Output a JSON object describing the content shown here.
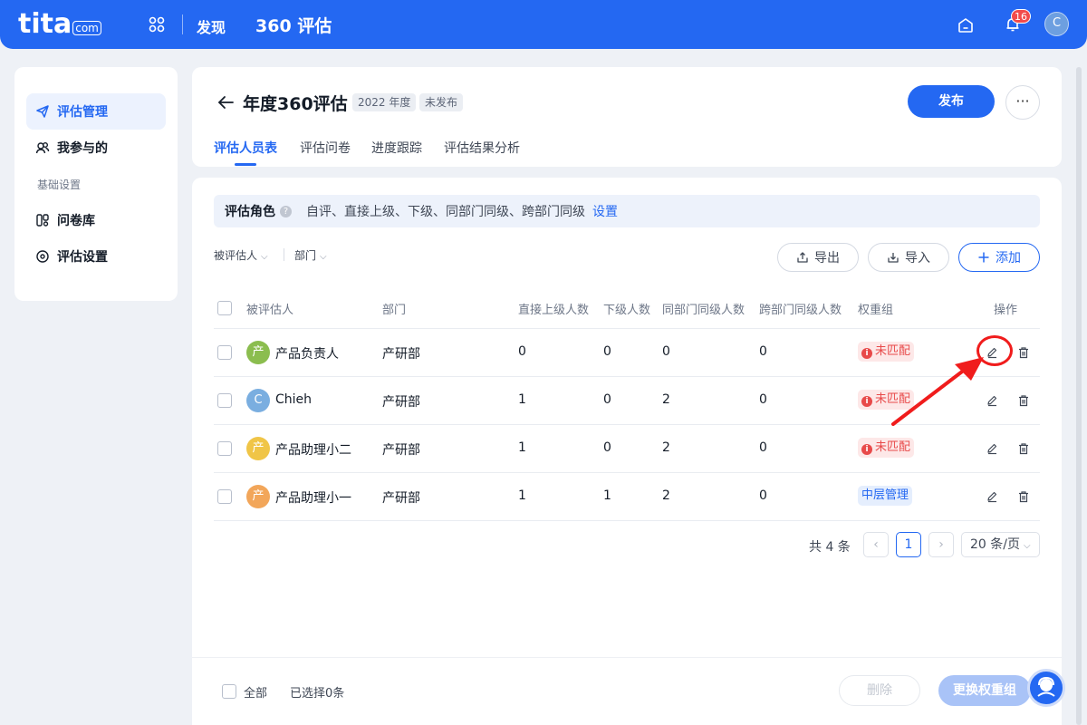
{
  "topbar": {
    "logo_text": "tita",
    "logo_suffix": "com",
    "nav_discover": "发现",
    "app_title": "360 评估",
    "notification_count": "16",
    "user_initial": "C"
  },
  "sidebar": {
    "items": [
      {
        "label": "评估管理",
        "icon": "send-icon"
      },
      {
        "label": "我参与的",
        "icon": "people-icon"
      },
      {
        "label": "问卷库",
        "icon": "questionnaire-icon"
      },
      {
        "label": "评估设置",
        "icon": "settings-icon"
      }
    ],
    "group_label": "基础设置"
  },
  "header": {
    "title": "年度360评估",
    "year_tag": "2022 年度",
    "status_tag": "未发布",
    "publish_label": "发布",
    "more_label": "···",
    "tabs": [
      "评估人员表",
      "评估问卷",
      "进度跟踪",
      "评估结果分析"
    ]
  },
  "roles": {
    "label": "评估角色",
    "help": "?",
    "text": "自评、直接上级、下级、同部门同级、跨部门同级",
    "link": "设置"
  },
  "filters": {
    "evaluatee": "被评估人",
    "department": "部门"
  },
  "actions": {
    "export": "导出",
    "import": "导入",
    "add": "添加"
  },
  "table": {
    "headers": [
      "被评估人",
      "部门",
      "直接上级人数",
      "下级人数",
      "同部门同级人数",
      "跨部门同级人数",
      "权重组",
      "操作"
    ],
    "rows": [
      {
        "avatar": "产",
        "avatar_color": "#8bbd4f",
        "name": "产品负责人",
        "dept": "产研部",
        "superior": "0",
        "subordinate": "0",
        "peer_same": "0",
        "peer_cross": "0",
        "weight": "未匹配",
        "weight_status": "red"
      },
      {
        "avatar": "C",
        "avatar_color": "#7aaee0",
        "name": "Chieh",
        "dept": "产研部",
        "superior": "1",
        "subordinate": "0",
        "peer_same": "2",
        "peer_cross": "0",
        "weight": "未匹配",
        "weight_status": "red"
      },
      {
        "avatar": "产",
        "avatar_color": "#f0c547",
        "name": "产品助理小二",
        "dept": "产研部",
        "superior": "1",
        "subordinate": "0",
        "peer_same": "2",
        "peer_cross": "0",
        "weight": "未匹配",
        "weight_status": "red"
      },
      {
        "avatar": "产",
        "avatar_color": "#f2a65a",
        "name": "产品助理小一",
        "dept": "产研部",
        "superior": "1",
        "subordinate": "1",
        "peer_same": "2",
        "peer_cross": "0",
        "weight": "中层管理",
        "weight_status": "blue"
      }
    ]
  },
  "pagination": {
    "total": "共 4 条",
    "prev": "‹",
    "current": "1",
    "next": "›",
    "page_size": "20 条/页"
  },
  "footer": {
    "select_all": "全部",
    "selected": "已选择0条",
    "delete": "删除",
    "change_weight": "更换权重组"
  },
  "colors": {
    "primary": "#2468f2",
    "danger": "#e84a4a",
    "annotation": "#f01c1c"
  }
}
